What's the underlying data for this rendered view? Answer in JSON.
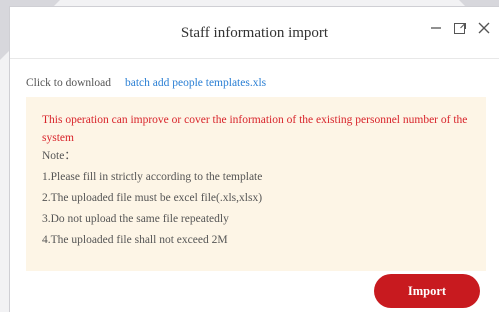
{
  "dialog": {
    "title": "Staff information import",
    "controls": {
      "minimize_icon": "minimize-icon",
      "maximize_icon": "maximize-icon",
      "close_icon": "close-icon"
    }
  },
  "download": {
    "label": "Click to download",
    "link_text": "batch add people templates.xls"
  },
  "notice": {
    "warning": "This operation can improve or cover the information of the existing personnel number of the system",
    "note_heading": "Note：",
    "items": [
      "1.Please fill in strictly according to the template",
      "2.The uploaded file must be excel file(.xls,xlsx)",
      "3.Do not upload the same file repeatedly",
      "4.The uploaded file shall not exceed 2M"
    ]
  },
  "actions": {
    "import_label": "Import"
  },
  "colors": {
    "accent": "#c81a1f",
    "link": "#2a7fd4",
    "warning_text": "#d8232a",
    "notice_bg": "#fdf5e6"
  }
}
